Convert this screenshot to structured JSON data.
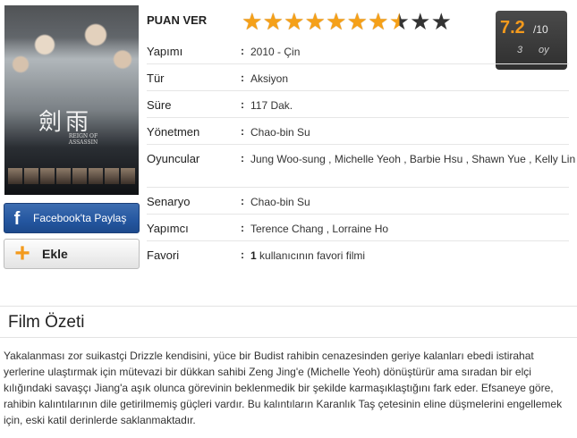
{
  "rating": {
    "label": "PUAN VER",
    "stars_total": 10,
    "stars_filled": 7.5,
    "score": "7.2",
    "out_of": "/10",
    "vote_count": "3",
    "vote_unit": "oy",
    "star_color": "#f5a018"
  },
  "details": {
    "yapimi_label": "Yapımı",
    "yapimi_value": "2010 - Çin",
    "tur_label": "Tür",
    "tur_value": "Aksiyon",
    "sure_label": "Süre",
    "sure_value": "117 Dak.",
    "yonetmen_label": "Yönetmen",
    "yonetmen_value": "Chao-bin Su",
    "oyuncular_label": "Oyuncular",
    "oyuncular_value": "Jung Woo-sung ,  Michelle Yeoh ,  Barbie Hsu ,  Shawn Yue ,  Kelly Lin",
    "senaryo_label": "Senaryo",
    "senaryo_value": "Chao-bin Su",
    "yapimci_label": "Yapımcı",
    "yapimci_value": "Terence Chang ,  Lorraine Ho",
    "favori_label": "Favori",
    "favori_count": "1",
    "favori_text": "kullanıcının favori filmi",
    "colon": ":"
  },
  "poster": {
    "calligraphy": "劍雨",
    "subtitle": "REIGN OF ASSASSIN"
  },
  "buttons": {
    "facebook_icon": "f",
    "facebook_label": "Facebook'ta Paylaş",
    "add_icon": "+",
    "add_label": "Ekle",
    "facebook_color": "#2456a0",
    "add_icon_color": "#f39a1d"
  },
  "summary": {
    "title": "Film Özeti",
    "text": "Yakalanması zor suikastçi Drizzle kendisini, yüce bir Budist rahibin cenazesinden geriye kalanları ebedi istirahat yerlerine ulaştırmak için mütevazi bir dükkan sahibi Zeng Jing'e (Michelle Yeoh) dönüştürür ama sıradan bir elçi kılığındaki savaşçı Jiang'a aşık olunca görevinin beklenmedik bir şekilde karmaşıklaştığını fark eder. Efsaneye göre, rahibin kalıntılarının dile getirilmemiş güçleri vardır. Bu kalıntıların Karanlık Taş çetesinin eline düşmelerini engellemek için, eski katil derinlerde saklanmaktadır."
  }
}
